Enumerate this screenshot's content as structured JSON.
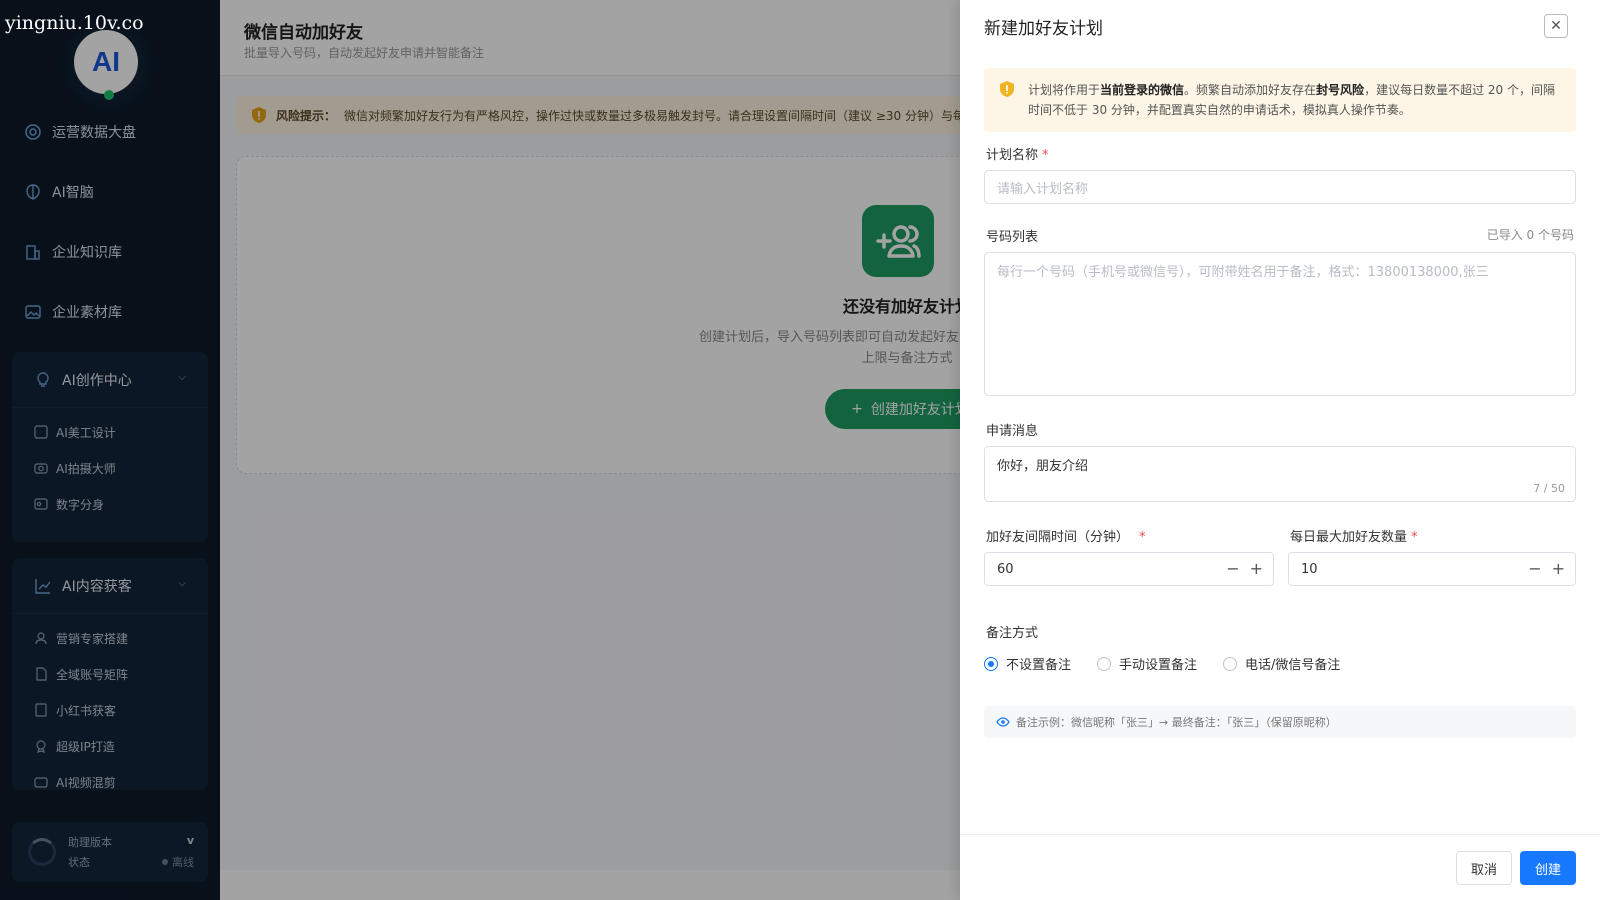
{
  "watermark": "yingniu.10v.co",
  "logo": {
    "text": "AI"
  },
  "sidebar": {
    "items": [
      {
        "label": "运营数据大盘",
        "icon": "dashboard-icon"
      },
      {
        "label": "AI智脑",
        "icon": "brain-icon"
      },
      {
        "label": "企业知识库",
        "icon": "building-icon"
      },
      {
        "label": "企业素材库",
        "icon": "image-icon"
      }
    ],
    "group_creation": {
      "title": "AI创作中心",
      "items": [
        {
          "label": "AI美工设计"
        },
        {
          "label": "AI拍摄大师"
        },
        {
          "label": "数字分身"
        }
      ]
    },
    "group_content": {
      "title": "AI内容获客",
      "items": [
        {
          "label": "营销专家搭建"
        },
        {
          "label": "全域账号矩阵"
        },
        {
          "label": "小红书获客"
        },
        {
          "label": "超级IP打造"
        },
        {
          "label": "AI视频混剪"
        }
      ]
    },
    "version": {
      "title": "助理版本",
      "status_label": "状态",
      "caret": "v",
      "status_value": "离线"
    }
  },
  "main": {
    "title": "微信自动加好友",
    "subtitle": "批量导入号码，自动发起好友申请并智能备注",
    "risk": {
      "prefix": "风险提示：",
      "text": "微信对频繁加好友行为有严格风控，操作过快或数量过多极易触发封号。请合理设置间隔时间（建议 ≥30 分钟）与每日数量"
    },
    "empty": {
      "title": "还没有加好友计划",
      "desc_line1": "创建计划后，导入号码列表即可自动发起好友申请，并可设置间隔、每日",
      "desc_line2": "上限与备注方式",
      "button": "创建加好友计划"
    }
  },
  "drawer": {
    "title": "新建加好友计划",
    "notice": {
      "t1": "计划将作用于",
      "b1": "当前登录的微信",
      "t2": "。频繁自动添加好友存在",
      "b2": "封号风险",
      "t3": "，建议每日数量不超过 20 个，间隔",
      "line2": "时间不低于 30 分钟，并配置真实自然的申请话术，模拟真人操作节奏。"
    },
    "plan_name": {
      "label": "计划名称",
      "placeholder": "请输入计划名称"
    },
    "number_list": {
      "label": "号码列表",
      "count": "已导入 0 个号码",
      "placeholder": "每行一个号码（手机号或微信号），可附带姓名用于备注，格式：13800138000,张三"
    },
    "message": {
      "label": "申请消息",
      "value": "你好，朋友介绍",
      "count": "7 / 50"
    },
    "interval": {
      "label": "加好友间隔时间（分钟）",
      "value": "60"
    },
    "daily_max": {
      "label": "每日最大加好友数量",
      "value": "10"
    },
    "remark": {
      "label": "备注方式",
      "options": [
        "不设置备注",
        "手动设置备注",
        "电话/微信号备注"
      ],
      "selected": "不设置备注"
    },
    "example": "备注示例：微信昵称「张三」→ 最终备注：「张三」（保留原昵称）",
    "cancel": "取消",
    "create": "创建"
  }
}
